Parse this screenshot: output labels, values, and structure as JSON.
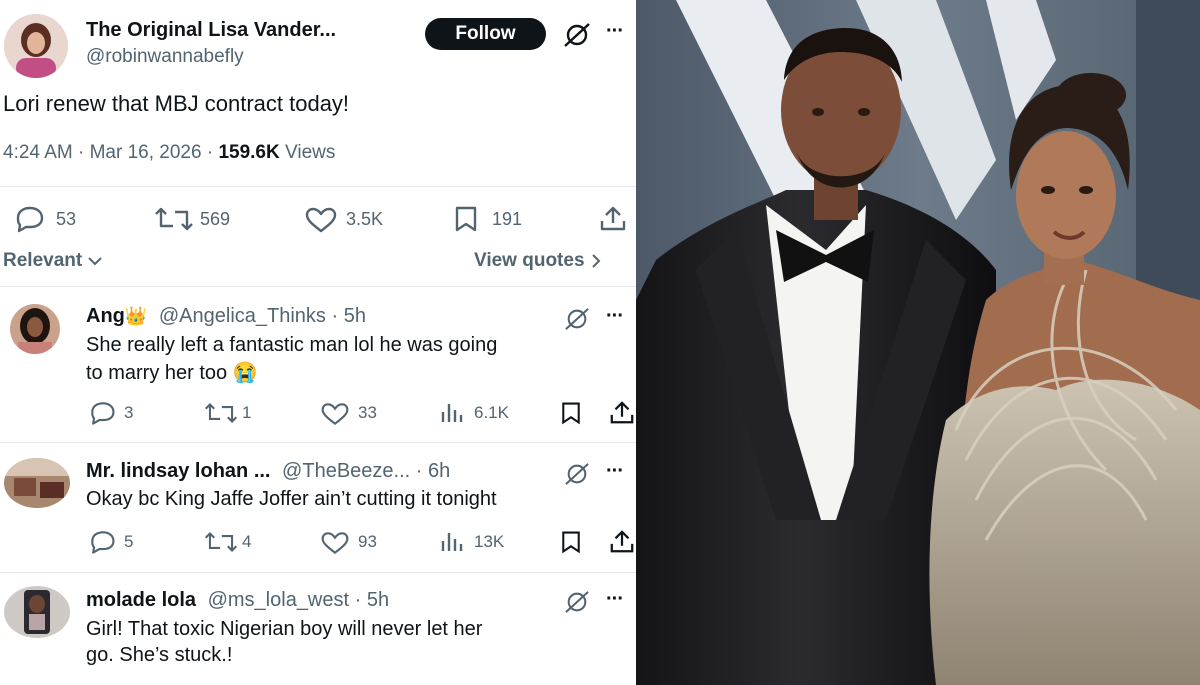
{
  "main_tweet": {
    "author_name": "The Original Lisa Vander...",
    "handle": "@robinwannabefly",
    "follow_label": "Follow",
    "more_label": "···",
    "text": "Lori renew that MBJ contract today!",
    "timestamp": "4:24 AM · Mar 16, 2026 ·",
    "views_count": "159.6K",
    "views_label": "Views",
    "replies": "53",
    "retweets": "569",
    "likes": "3.5K",
    "bookmarks": "191"
  },
  "sort": {
    "relevant_label": "Relevant",
    "view_quotes_label": "View quotes"
  },
  "replies": [
    {
      "name": "Ang",
      "badge": "👑",
      "handle_time": "@Angelica_Thinks · 5h",
      "line1": "She really left a fantastic man lol he was going",
      "line2": "to marry her too 😭",
      "replies": "3",
      "retweets": "1",
      "likes": "33",
      "views": "6.1K"
    },
    {
      "name": "Mr. lindsay lohan ...",
      "badge": "",
      "handle_time": "@TheBeeze... · 6h",
      "line1": "Okay bc King Jaffe Joffer ain’t cutting it tonight",
      "line2": "",
      "replies": "5",
      "retweets": "4",
      "likes": "93",
      "views": "13K"
    },
    {
      "name": "molade lola",
      "badge": "",
      "handle_time": "@ms_lola_west · 5h",
      "line1": "Girl! That toxic Nigerian boy will never let her",
      "line2": "go. She’s stuck.!",
      "replies": "",
      "retweets": "",
      "likes": "",
      "views": ""
    }
  ],
  "colors": {
    "text": "#0f1419",
    "secondary": "#536471",
    "follow_bg": "#0f1419",
    "divider": "#e6e9ec"
  },
  "icons": [
    "grok-icon",
    "more-icon",
    "reply-icon",
    "retweet-icon",
    "like-icon",
    "bookmark-icon",
    "share-icon",
    "views-icon",
    "chevron-down-icon",
    "chevron-right-icon"
  ]
}
